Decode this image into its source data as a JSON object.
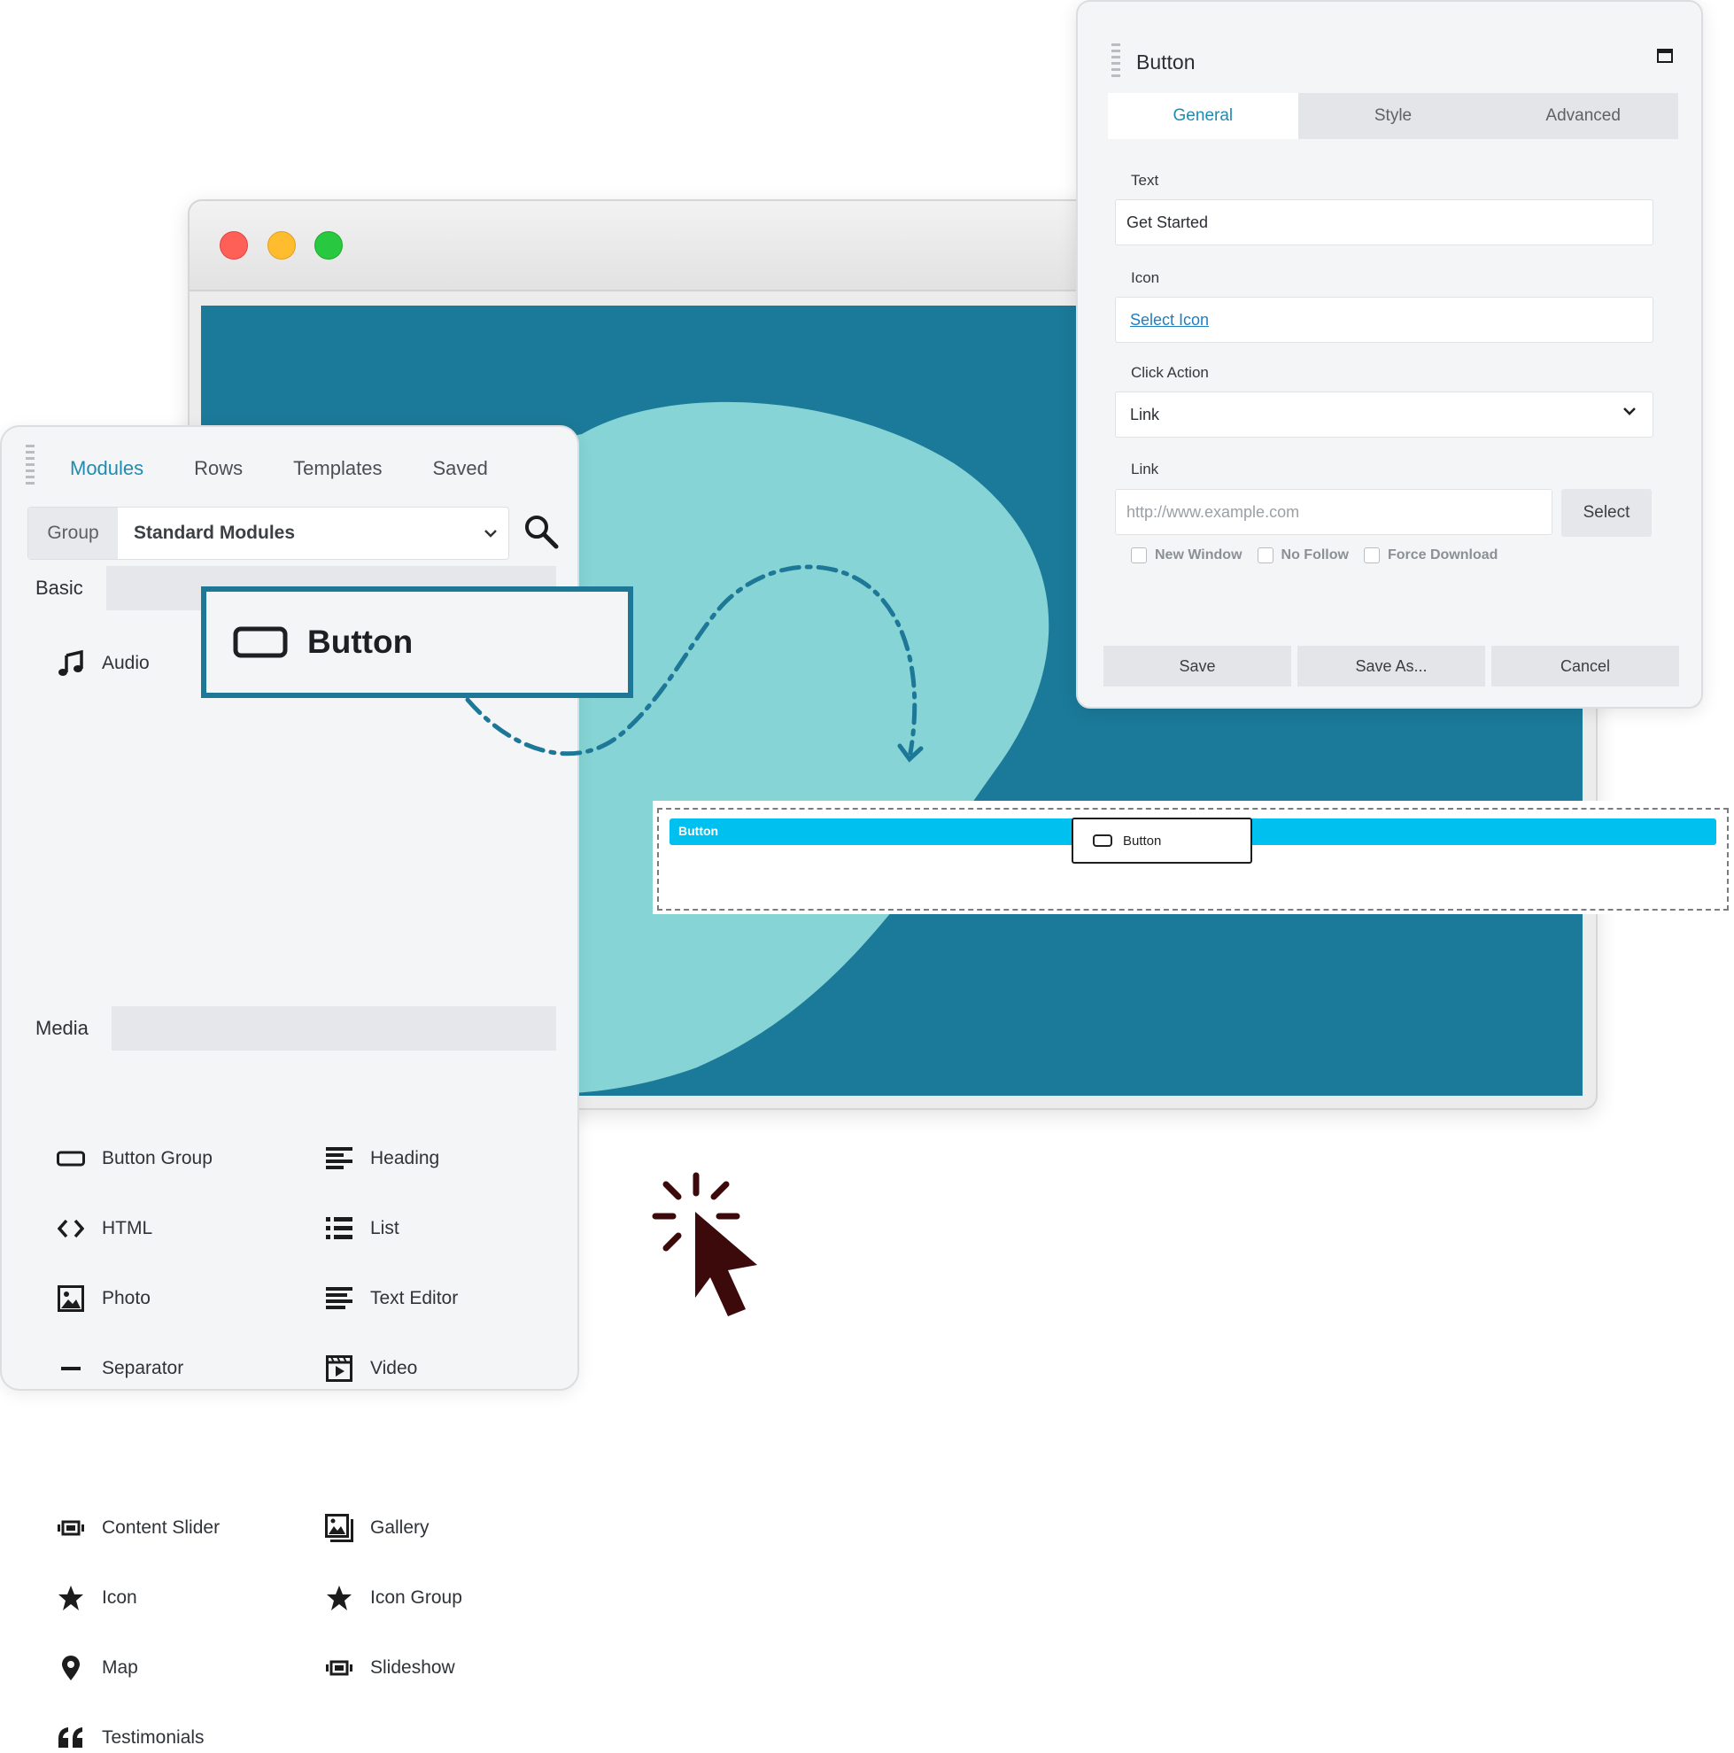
{
  "panel": {
    "tabs": [
      "Modules",
      "Rows",
      "Templates",
      "Saved"
    ],
    "group_label": "Group",
    "group_value": "Standard Modules",
    "sections": {
      "basic": "Basic",
      "media": "Media"
    },
    "basic_modules": [
      {
        "label": "Audio",
        "icon": "music-note-icon"
      },
      {
        "label": "Button Group",
        "icon": "button-icon"
      },
      {
        "label": "Heading",
        "icon": "heading-icon"
      },
      {
        "label": "HTML",
        "icon": "code-icon"
      },
      {
        "label": "List",
        "icon": "list-icon"
      },
      {
        "label": "Photo",
        "icon": "photo-icon"
      },
      {
        "label": "Text Editor",
        "icon": "text-editor-icon"
      },
      {
        "label": "Separator",
        "icon": "separator-icon"
      },
      {
        "label": "Video",
        "icon": "video-icon"
      }
    ],
    "media_modules": [
      {
        "label": "Content Slider",
        "icon": "slider-icon"
      },
      {
        "label": "Gallery",
        "icon": "gallery-icon"
      },
      {
        "label": "Icon",
        "icon": "star-icon"
      },
      {
        "label": "Icon Group",
        "icon": "star-icon"
      },
      {
        "label": "Map",
        "icon": "map-pin-icon"
      },
      {
        "label": "Slideshow",
        "icon": "slider-icon"
      },
      {
        "label": "Testimonials",
        "icon": "quote-icon"
      }
    ]
  },
  "drag_card": {
    "label": "Button",
    "icon": "button-icon"
  },
  "dropzone": {
    "bar_label": "Button",
    "chip_label": "Button"
  },
  "dialog": {
    "title": "Button",
    "tabs": [
      "General",
      "Style",
      "Advanced"
    ],
    "fields": {
      "text_label": "Text",
      "text_value": "Get Started",
      "icon_label": "Icon",
      "icon_link": "Select Icon",
      "click_action_label": "Click Action",
      "click_action_value": "Link",
      "link_label": "Link",
      "link_placeholder": "http://www.example.com",
      "select_button": "Select"
    },
    "checkboxes": [
      "New Window",
      "No Follow",
      "Force Download"
    ],
    "buttons": [
      "Save",
      "Save As...",
      "Cancel"
    ]
  },
  "colors": {
    "accent": "#1f8bb0",
    "canvas": "#1b7a99",
    "blob": "#86d4d5",
    "drop_bar": "#00c0f0",
    "cursor": "#3c0a0a"
  }
}
